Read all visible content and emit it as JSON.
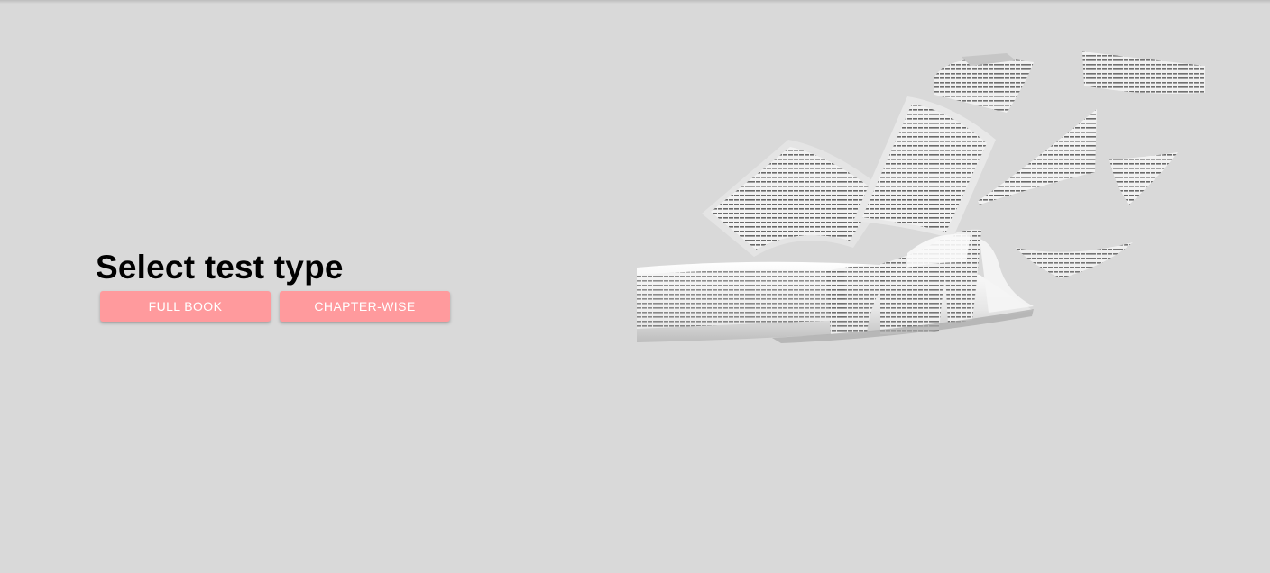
{
  "heading": "Select test type",
  "buttons": {
    "full_book": "FULL BOOK",
    "chapter_wise": "CHAPTER-WISE"
  },
  "colors": {
    "background": "#d9d9d9",
    "button": "#ff9a9d",
    "button_text": "#ffffff"
  },
  "illustration": "flying-pages-image"
}
